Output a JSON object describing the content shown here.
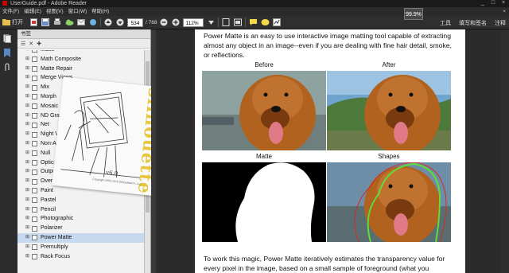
{
  "window": {
    "title": "UserGuide.pdf - Adobe Reader",
    "controls": [
      "_",
      "□",
      "×"
    ]
  },
  "menu": {
    "items": [
      "文件(F)",
      "编辑(E)",
      "视图(V)",
      "窗口(W)",
      "帮助(H)"
    ],
    "close_doc": "×"
  },
  "toolbar": {
    "open_label": "打开",
    "page_current": "534",
    "page_total": "/ 768",
    "zoom": "112%",
    "right_links": [
      "工具",
      "填写和签名",
      "注释"
    ],
    "progress_badge": "99.9%"
  },
  "bookmarks": {
    "header": "书签",
    "items": [
      {
        "label": "Matte",
        "selected": false
      },
      {
        "label": "Math Composite",
        "selected": false
      },
      {
        "label": "Matte Repair",
        "selected": false
      },
      {
        "label": "Merge Views",
        "selected": false
      },
      {
        "label": "Mix",
        "selected": false
      },
      {
        "label": "Morph",
        "selected": false
      },
      {
        "label": "Mosaic",
        "selected": false
      },
      {
        "label": "ND Gradient",
        "selected": false
      },
      {
        "label": "Net",
        "selected": false
      },
      {
        "label": "Night Vision",
        "selected": false
      },
      {
        "label": "Non-Additive Mix",
        "selected": false
      },
      {
        "label": "Null",
        "selected": false
      },
      {
        "label": "Optical Distortion",
        "selected": false
      },
      {
        "label": "Output / Clamp",
        "selected": false
      },
      {
        "label": "Overexpose",
        "selected": false
      },
      {
        "label": "Paint",
        "selected": false
      },
      {
        "label": "Pastel",
        "selected": false
      },
      {
        "label": "Pencil",
        "selected": false
      },
      {
        "label": "Photographic",
        "selected": false
      },
      {
        "label": "Polarizer",
        "selected": false
      },
      {
        "label": "Power Matte",
        "selected": true
      },
      {
        "label": "Premultiply",
        "selected": false
      },
      {
        "label": "Rack Focus",
        "selected": false
      }
    ]
  },
  "logo": {
    "word": "silhouette",
    "version": "v6.0",
    "copyright": "Copyright 2005-2016 SilhouetteFX, LLC"
  },
  "document": {
    "intro": "Power Matte is an easy to use interactive image matting tool capable of extracting almost any object in an image--even if you are dealing with fine hair detail, smoke, or reflections.",
    "labels": {
      "before": "Before",
      "after": "After",
      "matte": "Matte",
      "shapes": "Shapes"
    },
    "outro": "To work this magic, Power Matte iteratively estimates the transparency value for every pixel in the image, based on a small sample of foreground (what you"
  }
}
